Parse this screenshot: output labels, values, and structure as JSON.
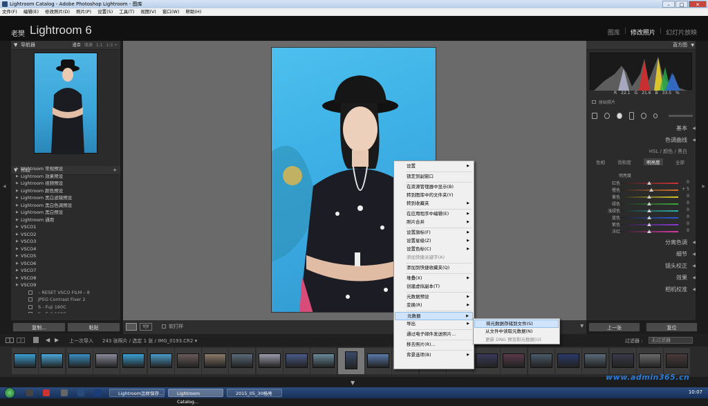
{
  "window": {
    "title": "Lightroom Catalog - Adobe Photoshop Lightroom - 图库",
    "controls": [
      "–",
      "□",
      "✕"
    ]
  },
  "menu": [
    "文件(F)",
    "编辑(E)",
    "修改照片(D)",
    "照片(P)",
    "设置(S)",
    "工具(T)",
    "视图(V)",
    "窗口(W)",
    "帮助(H)"
  ],
  "identity": {
    "prefix": "老樊",
    "name": "Lightroom 6"
  },
  "modules": {
    "library": "图库",
    "develop": "修改照片",
    "slideshow": "幻灯片放映",
    "sep": "|"
  },
  "left": {
    "navigator": "导航器",
    "zoom": [
      "适合",
      "填满",
      "1:1",
      "1:3 ÷"
    ],
    "presets_title": "预设",
    "add": "+",
    "presets": [
      {
        "label": "Lightroom 常规预设",
        "sub": false
      },
      {
        "label": "Lightroom 效果预设",
        "sub": false
      },
      {
        "label": "Lightroom 视频预设",
        "sub": false
      },
      {
        "label": "Lightroom 颜色预设",
        "sub": false
      },
      {
        "label": "Lightroom 黑白滤镜预设",
        "sub": false
      },
      {
        "label": "Lightroom 黑白色调预设",
        "sub": false
      },
      {
        "label": "Lightroom 黑白预设",
        "sub": false
      },
      {
        "label": "Lightroom 通用",
        "sub": false
      },
      {
        "label": "VSCO1",
        "sub": false
      },
      {
        "label": "VSCO2",
        "sub": false
      },
      {
        "label": "VSCO3",
        "sub": false
      },
      {
        "label": "VSCO4",
        "sub": false
      },
      {
        "label": "VSCO5",
        "sub": false
      },
      {
        "label": "VSCO6",
        "sub": false
      },
      {
        "label": "VSCO7",
        "sub": false
      },
      {
        "label": "VSCO8",
        "sub": false
      },
      {
        "label": "VSCO9",
        "sub": false
      },
      {
        "label": "– RESET VSCO FILM – 8",
        "sub": true
      },
      {
        "label": "JPEG Contrast Fixer 2",
        "sub": true
      },
      {
        "label": "S - Fuji 160C",
        "sub": true
      },
      {
        "label": "S - Fuji 160C",
        "sub": true
      }
    ],
    "copy": "复制...",
    "paste": "粘贴"
  },
  "toolbar": {
    "softproof": "软打样",
    "view_label": "Y|Y"
  },
  "right": {
    "histogram": "直方图",
    "hist_r": "R",
    "hist_r_val": "22.1",
    "hist_g": "G",
    "hist_g_val": "21.6",
    "hist_b": "B",
    "hist_b_val": "33.5",
    "hist_pct": "%",
    "original": "原始照片",
    "sections_top": [
      "基本",
      "色调曲线"
    ],
    "hsl_head": "HSL  /  颜色  /  黑白",
    "hsl_tabs": [
      "色相",
      "饱和度",
      "明亮度",
      "全部"
    ],
    "hsl_sub": "明亮度",
    "hsl_rows": [
      {
        "label": "红色",
        "value": "0",
        "pos": 0.5
      },
      {
        "label": "橙色",
        "value": "+ 5",
        "pos": 0.53
      },
      {
        "label": "黄色",
        "value": "0",
        "pos": 0.5
      },
      {
        "label": "绿色",
        "value": "0",
        "pos": 0.5
      },
      {
        "label": "浅绿色",
        "value": "0",
        "pos": 0.5
      },
      {
        "label": "蓝色",
        "value": "0",
        "pos": 0.5
      },
      {
        "label": "紫色",
        "value": "0",
        "pos": 0.5
      },
      {
        "label": "洋红",
        "value": "0",
        "pos": 0.5
      }
    ],
    "sections_bottom": [
      "分离色调",
      "细节",
      "镜头校正",
      "效果",
      "相机校准"
    ],
    "prev": "上一张",
    "reset": "复位"
  },
  "filmstrip": {
    "pages": [
      "1",
      "2"
    ],
    "source": "上一次导入",
    "count": "243 张照片 / 选定 1 张 / IMG_0193.CR2 ▾",
    "filter_label": "过滤器 :",
    "filter_value": "无过滤器"
  },
  "context_menu": {
    "items": [
      {
        "label": "设置",
        "arrow": true,
        "dis": false,
        "hl": false
      },
      {
        "label": "锁定到副窗口",
        "arrow": false,
        "dis": false,
        "hl": false
      },
      {
        "label": "在资源管理器中显示(B)",
        "arrow": false,
        "dis": false,
        "hl": false
      },
      {
        "label": "转到图库中的文件夹(Y)",
        "arrow": false,
        "dis": false,
        "hl": false
      },
      {
        "label": "转到收藏夹",
        "arrow": true,
        "dis": false,
        "hl": false
      },
      {
        "label": "在应用程序中编辑(E)",
        "arrow": true,
        "dis": false,
        "hl": false
      },
      {
        "label": "照片合并",
        "arrow": true,
        "dis": false,
        "hl": false
      },
      {
        "label": "设置旗标(F)",
        "arrow": true,
        "dis": false,
        "hl": false
      },
      {
        "label": "设置星级(Z)",
        "arrow": true,
        "dis": false,
        "hl": false
      },
      {
        "label": "设置色标(C)",
        "arrow": true,
        "dis": false,
        "hl": false
      },
      {
        "label": "添加快捷关键字(A)",
        "arrow": false,
        "dis": true,
        "hl": false
      },
      {
        "label": "添加到快捷收藏夹(Q)",
        "arrow": false,
        "dis": false,
        "hl": false
      },
      {
        "label": "堆叠(X)",
        "arrow": true,
        "dis": false,
        "hl": false
      },
      {
        "label": "创建虚拟副本(T)",
        "arrow": false,
        "dis": false,
        "hl": false
      },
      {
        "label": "元数据预设",
        "arrow": true,
        "dis": false,
        "hl": false
      },
      {
        "label": "变换(R)",
        "arrow": true,
        "dis": false,
        "hl": false
      },
      {
        "label": "元数据",
        "arrow": true,
        "dis": false,
        "hl": true
      },
      {
        "label": "导出",
        "arrow": true,
        "dis": false,
        "hl": false
      },
      {
        "label": "通过电子邮件发送照片...",
        "arrow": false,
        "dis": false,
        "hl": false
      },
      {
        "label": "移去照片(R)...",
        "arrow": false,
        "dis": false,
        "hl": false
      },
      {
        "label": "背景选项(B)",
        "arrow": true,
        "dis": false,
        "hl": false
      }
    ]
  },
  "submenu": {
    "items": [
      {
        "label": "将元数据存储到文件(S)",
        "dis": false,
        "hl": true
      },
      {
        "label": "从文件中读取元数据(N)",
        "dis": false,
        "hl": false
      },
      {
        "label": "更新 DNG 预览和元数据(U)",
        "dis": true,
        "hl": false
      }
    ]
  },
  "taskbar": {
    "items": [
      "Lightroom怎样保存...",
      "Lightroom Catalog...",
      "2015_05_30杨亮"
    ],
    "clock": "10:07"
  },
  "watermark": "www.admin365.cn",
  "colors": {
    "accent": "#2a7bd8",
    "menu_highlight": "#cfe3fb",
    "panel": "#2b2b2b"
  }
}
